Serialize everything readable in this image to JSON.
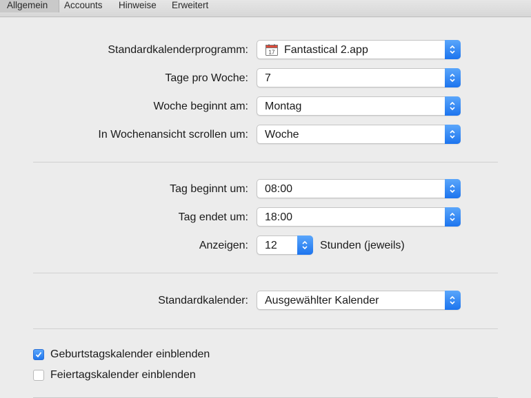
{
  "tabs": [
    {
      "label": "Allgemein",
      "active": true
    },
    {
      "label": "Accounts",
      "active": false
    },
    {
      "label": "Hinweise",
      "active": false
    },
    {
      "label": "Erweitert",
      "active": false
    }
  ],
  "settings": {
    "default_app": {
      "label": "Standardkalenderprogramm:",
      "value": "Fantastical 2.app",
      "icon": "calendar-icon"
    },
    "days_per_week": {
      "label": "Tage pro Woche:",
      "value": "7"
    },
    "week_starts": {
      "label": "Woche beginnt am:",
      "value": "Montag"
    },
    "week_scroll": {
      "label": "In Wochenansicht scrollen um:",
      "value": "Woche"
    },
    "day_starts": {
      "label": "Tag beginnt um:",
      "value": "08:00"
    },
    "day_ends": {
      "label": "Tag endet um:",
      "value": "18:00"
    },
    "show": {
      "label": "Anzeigen:",
      "value": "12",
      "suffix": "Stunden (jeweils)"
    },
    "default_calendar": {
      "label": "Standardkalender:",
      "value": "Ausgewählter Kalender"
    }
  },
  "checkboxes": [
    {
      "label": "Geburtstagskalender einblenden",
      "checked": true
    },
    {
      "label": "Feiertagskalender einblenden",
      "checked": false
    }
  ],
  "colors": {
    "accent": "#1c74ee",
    "background": "#ececec"
  }
}
